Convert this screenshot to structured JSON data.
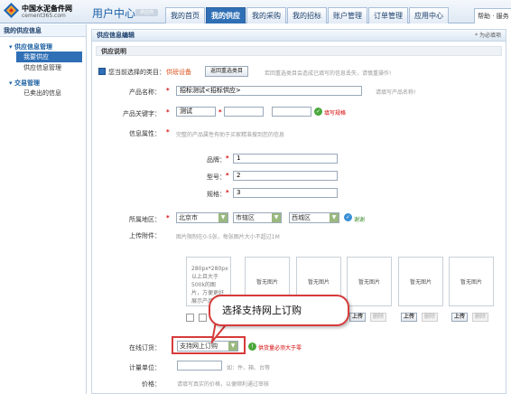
{
  "brand": {
    "logo_line1": "中国水泥备件网",
    "logo_line2": "cement365.com",
    "center_title": "用户中心",
    "center_badge": "供应商"
  },
  "nav": {
    "tabs": [
      {
        "label": "我的首页",
        "active": false
      },
      {
        "label": "我的供应",
        "active": true
      },
      {
        "label": "我的采购",
        "active": false
      },
      {
        "label": "我的招标",
        "active": false
      },
      {
        "label": "账户管理",
        "active": false
      },
      {
        "label": "订单管理",
        "active": false
      },
      {
        "label": "应用中心",
        "active": false
      }
    ],
    "help": "帮助 · 服务"
  },
  "sidebar": {
    "header": "我的供应信息",
    "groups": [
      {
        "title": "供应信息管理",
        "items": [
          {
            "label": "我要供应",
            "active": true
          },
          {
            "label": "供应信息管理",
            "active": false
          }
        ]
      },
      {
        "title": "交易管理",
        "items": [
          {
            "label": "已卖出的信息",
            "active": false
          }
        ]
      }
    ]
  },
  "main": {
    "title": "供应信息编辑",
    "required_note": "* 为必填项",
    "section": "供应说明",
    "category": {
      "prefix": "您当前选择的类目：",
      "value": "供磅设备",
      "reselect_btn": "返回重选类目",
      "hint": "若回重选类目会造成已填写的信息丢失，请慎重操作!"
    },
    "product_name": {
      "label": "产品名称：",
      "value": "招标测试<招标供应>",
      "hint": "请填写产品名称!"
    },
    "keywords": {
      "label": "产品关键字：",
      "values": [
        "测试",
        "",
        ""
      ],
      "status": "填写规格"
    },
    "attributes": {
      "label": "信息属性：",
      "hint": "完整的产品属性有助于买家精准搜到您的信息",
      "fields": [
        {
          "label": "品牌：",
          "value": "1"
        },
        {
          "label": "型号：",
          "value": "2"
        },
        {
          "label": "规格：",
          "value": "3"
        }
      ]
    },
    "region": {
      "label": "所属地区：",
      "province": "北京市",
      "city": "市辖区",
      "district": "西城区",
      "status": "谢谢"
    },
    "images": {
      "label": "上传附件：",
      "hint": "图片限制在0-5张，每张图片大小不超过1M",
      "first_slot_text": "280px*280px 以上且大于500k的图片，方便更好展示产品",
      "placeholder": "暂无图片",
      "upload_btn": "上传",
      "delete_btn": "删除"
    },
    "online_order": {
      "label": "在线订货：",
      "value": "支持网上订购",
      "hint": "供货量必须大于零"
    },
    "unit": {
      "label": "计量单位：",
      "hint": "如：件、箱、台等"
    },
    "price": {
      "label": "价格：",
      "hint": "请填写真实的价格，以便顺利通过审核"
    }
  },
  "callout": {
    "text": "选择支持网上订购"
  },
  "icons": {
    "ok": "check-circle-icon",
    "info": "info-icon",
    "caret": "dropdown-caret-icon"
  },
  "colors": {
    "nav_active": "#2f6fb5",
    "required": "#d40000",
    "callout_border": "#d63b3b",
    "ok": "#4aa83a"
  }
}
